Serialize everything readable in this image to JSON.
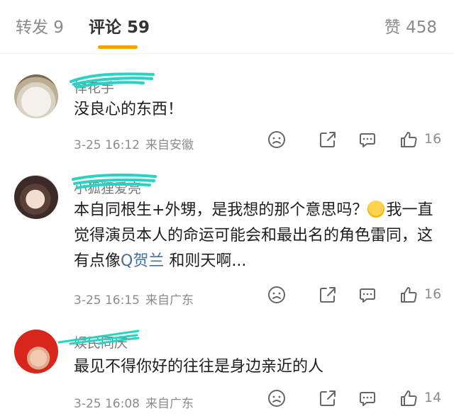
{
  "tabs": {
    "repost": "转发 9",
    "comments": "评论 59",
    "likes": "赞 458"
  },
  "colors": {
    "accent": "#f5a300",
    "topic_link": "#476f9e",
    "scribble": "#27d3c3"
  },
  "comments": [
    {
      "name": "悍花手",
      "text": "没良心的东西！",
      "time": "3-25 16:12",
      "location": "来自安徽",
      "likes": "16"
    },
    {
      "name": "小狐狸爱亮",
      "text_part1": "本自同根生+外甥，是我想的那个意思吗？",
      "text_part2": "我一直觉得演员本人的命运可能会和最出名的角色雷同，这有点像",
      "topic": "Q贺兰",
      "text_part3": " 和则天啊...",
      "time": "3-25 16:15",
      "location": "来自广东",
      "likes": "16"
    },
    {
      "name": "娱民同庆",
      "text": "最见不得你好的往往是身边亲近的人",
      "time": "3-25 16:08",
      "location": "来自广东",
      "likes": "14"
    }
  ],
  "icons": [
    "dislike-icon",
    "share-icon",
    "reply-icon",
    "like-icon"
  ]
}
